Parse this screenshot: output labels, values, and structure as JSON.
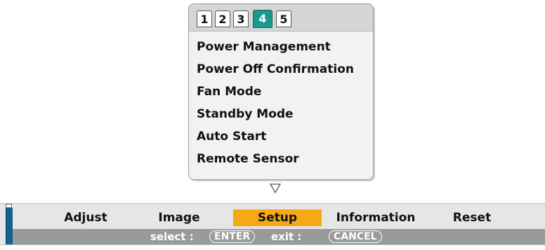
{
  "submenu": {
    "tabs": [
      {
        "label": "1",
        "active": false
      },
      {
        "label": "2",
        "active": false
      },
      {
        "label": "3",
        "active": false
      },
      {
        "label": "4",
        "active": true
      },
      {
        "label": "5",
        "active": false
      }
    ],
    "items": [
      "Power Management",
      "Power Off Confirmation",
      "Fan Mode",
      "Standby Mode",
      "Auto Start",
      "Remote Sensor"
    ],
    "more_indicator_icon": "down-triangle-icon"
  },
  "menubar": {
    "items": [
      {
        "label": "Adjust",
        "selected": false
      },
      {
        "label": "Image",
        "selected": false
      },
      {
        "label": "Setup",
        "selected": true
      },
      {
        "label": "Information",
        "selected": false
      },
      {
        "label": "Reset",
        "selected": false
      }
    ],
    "hints": {
      "select_label": "select :",
      "select_key": "ENTER",
      "exit_label": "exit :",
      "exit_key": "CANCEL"
    }
  },
  "colors": {
    "active_tab": "#1a9a8c",
    "selected_menu": "#f6a817",
    "hint_bar": "#9a9a9a",
    "edge_bar": "#19628c"
  }
}
